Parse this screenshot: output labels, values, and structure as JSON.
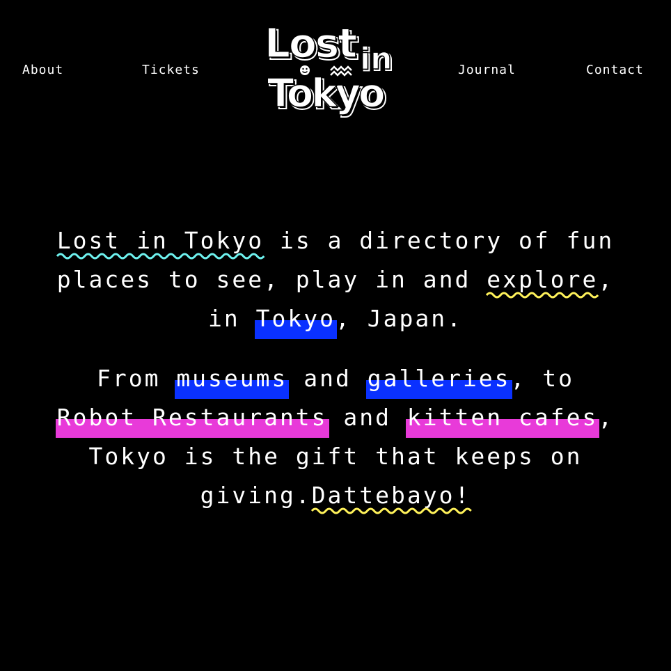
{
  "nav": {
    "items": [
      {
        "label": "About"
      },
      {
        "label": "Tickets"
      },
      {
        "label": "Journal"
      },
      {
        "label": "Contact"
      }
    ]
  },
  "logo": {
    "line1": "Lost",
    "line1b": "in",
    "line2": "Tokyo",
    "icon": "smiley-icon"
  },
  "intro": {
    "p1": {
      "lost_in_tokyo": "Lost in Tokyo",
      "t1": " is a directory of fun",
      "t2": "places to see, play in and ",
      "explore": "explore",
      "t3": ",",
      "t4": "in ",
      "tokyo": "Tokyo",
      "t5": ", Japan."
    },
    "p2": {
      "t1": "From ",
      "museums": "museums",
      "t2": " and ",
      "galleries": "galleries",
      "t3": ", to",
      "robot": "Robot Restaurants",
      "t4": " and ",
      "kitten": "kitten cafes",
      "t5": ",",
      "t6": "Tokyo is the gift that keeps on",
      "t7": "giving.",
      "dattebayo": "Dattebayo!"
    }
  },
  "colors": {
    "background": "#000000",
    "text": "#ffffff",
    "cyan_squiggle": "#6ef2ef",
    "yellow_squiggle": "#fff25a",
    "blue_highlight": "#0a31ff",
    "pink_highlight": "#e83ad9"
  }
}
